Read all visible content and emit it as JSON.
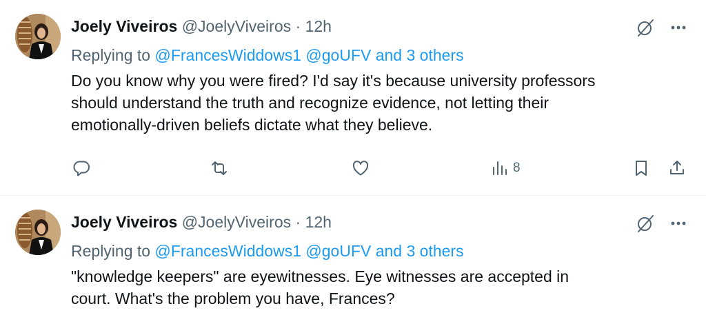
{
  "tweets": [
    {
      "author": {
        "name": "Joely Viveiros",
        "handle": "@JoelyViveiros",
        "avatar_icon": "profile-photo"
      },
      "separator": "·",
      "time": "12h",
      "reply": {
        "prefix": "Replying to",
        "mentions": [
          "@FrancesWiddows1",
          "@goUFV",
          "and 3 others"
        ]
      },
      "text_lines": [
        "Do you know why you were fired?  I'd say it's because university professors",
        "should understand the truth and recognize evidence, not letting their",
        "emotionally-driven beliefs dictate what they believe."
      ],
      "actions": {
        "reply_icon": "comment-icon",
        "retweet_icon": "retweet-icon",
        "like_icon": "heart-icon",
        "views_icon": "views-icon",
        "views_count": "8",
        "bookmark_icon": "bookmark-icon",
        "share_icon": "share-icon"
      }
    },
    {
      "author": {
        "name": "Joely Viveiros",
        "handle": "@JoelyViveiros",
        "avatar_icon": "profile-photo"
      },
      "separator": "·",
      "time": "12h",
      "reply": {
        "prefix": "Replying to",
        "mentions": [
          "@FrancesWiddows1",
          "@goUFV",
          "and 3 others"
        ]
      },
      "text_lines": [
        "\"knowledge keepers\" are eyewitnesses.  Eye witnesses are accepted in",
        "court.  What's the problem you have, Frances?"
      ]
    }
  ],
  "colors": {
    "text": "#0f1419",
    "secondary": "#536471",
    "link": "#1d9bf0",
    "divider": "#eff3f4"
  }
}
